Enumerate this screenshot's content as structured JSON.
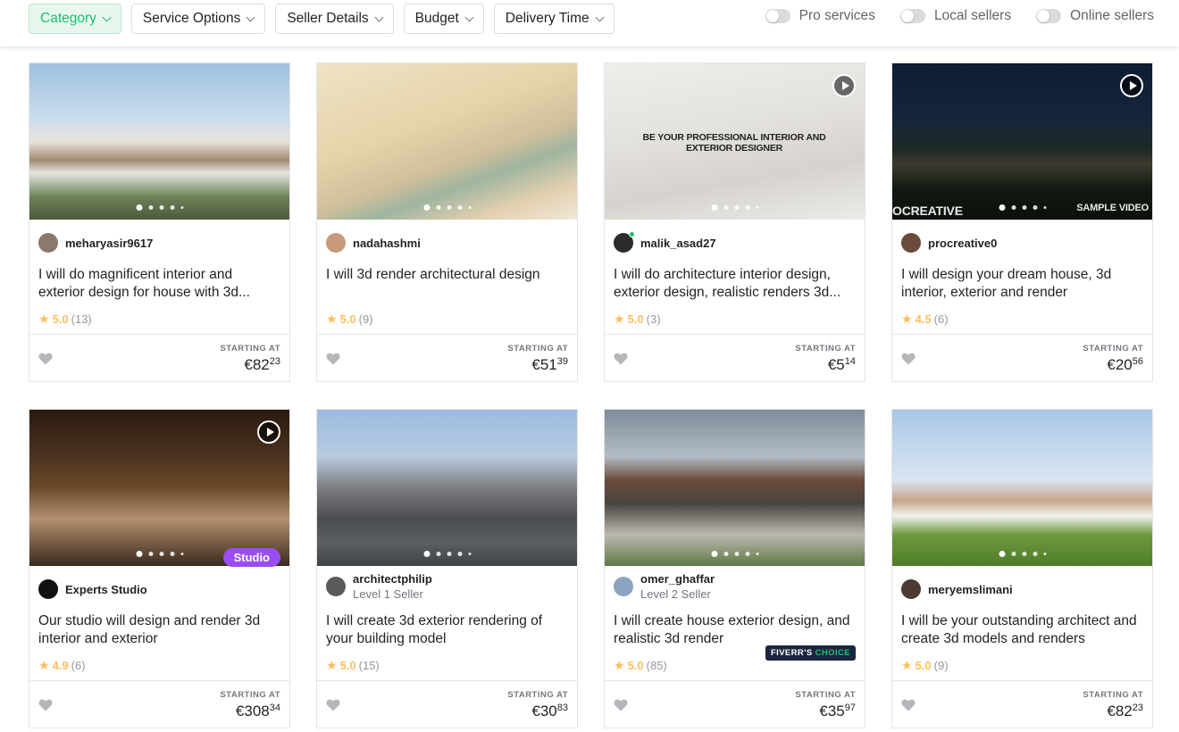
{
  "filters": [
    {
      "label": "Category",
      "active": true
    },
    {
      "label": "Service Options",
      "active": false
    },
    {
      "label": "Seller Details",
      "active": false
    },
    {
      "label": "Budget",
      "active": false
    },
    {
      "label": "Delivery Time",
      "active": false
    }
  ],
  "toggles": [
    {
      "label": "Pro services",
      "on": false
    },
    {
      "label": "Local sellers",
      "on": false
    },
    {
      "label": "Online sellers",
      "on": false
    }
  ],
  "colors": {
    "accent": "#1dbf73",
    "rating": "#ffbe5b",
    "studio_badge": "#9a4df4",
    "choice_badge": "#1c2540"
  },
  "starting_at_label": "STARTING AT",
  "gigs": [
    {
      "seller": "meharyasir9617",
      "level": "",
      "online": false,
      "title": "I will do magnificent interior and exterior design for house with 3d...",
      "rating": "5.0",
      "reviews": "(13)",
      "price_main": "€82",
      "price_cents": "23",
      "has_video": false,
      "badge": "",
      "thumb_icon": "house-exterior-image",
      "overlay": ""
    },
    {
      "seller": "nadahashmi",
      "level": "",
      "online": false,
      "title": "I will 3d render architectural design",
      "rating": "5.0",
      "reviews": "(9)",
      "price_main": "€51",
      "price_cents": "39",
      "has_video": false,
      "badge": "",
      "thumb_icon": "classic-interior-image",
      "overlay": ""
    },
    {
      "seller": "malik_asad27",
      "level": "",
      "online": true,
      "title": "I will do architecture interior design, exterior design, realistic renders 3d...",
      "rating": "5.0",
      "reviews": "(3)",
      "price_main": "€5",
      "price_cents": "14",
      "has_video": true,
      "badge": "",
      "thumb_icon": "white-interior-image",
      "overlay": "BE YOUR PROFESSIONAL INTERIOR AND EXTERIOR DESIGNER"
    },
    {
      "seller": "procreative0",
      "level": "",
      "online": false,
      "title": "I will design your dream house, 3d interior, exterior and render",
      "rating": "4.5",
      "reviews": "(6)",
      "price_main": "€20",
      "price_cents": "56",
      "has_video": true,
      "badge": "",
      "thumb_icon": "night-house-image",
      "overlay": "OCREATIVE",
      "overlay2": "SAMPLE VIDEO"
    },
    {
      "seller": "Experts Studio",
      "level": "",
      "online": false,
      "title": "Our studio will design and render 3d interior and exterior",
      "rating": "4.9",
      "reviews": "(6)",
      "price_main": "€308",
      "price_cents": "34",
      "has_video": true,
      "badge": "Studio",
      "thumb_icon": "library-interior-image",
      "overlay": ""
    },
    {
      "seller": "architectphilip",
      "level": "Level 1 Seller",
      "online": false,
      "title": "I will create 3d exterior rendering of your building model",
      "rating": "5.0",
      "reviews": "(15)",
      "price_main": "€30",
      "price_cents": "83",
      "has_video": false,
      "badge": "",
      "thumb_icon": "modern-house-image",
      "overlay": ""
    },
    {
      "seller": "omer_ghaffar",
      "level": "Level 2 Seller",
      "online": false,
      "title": "I will create house exterior design, and realistic 3d render",
      "rating": "5.0",
      "reviews": "(85)",
      "price_main": "€35",
      "price_cents": "97",
      "has_video": false,
      "badge": "choice",
      "thumb_icon": "brick-house-image",
      "overlay": ""
    },
    {
      "seller": "meryemslimani",
      "level": "",
      "online": false,
      "title": "I will be your outstanding architect and create 3d models and renders",
      "rating": "5.0",
      "reviews": "(9)",
      "price_main": "€82",
      "price_cents": "23",
      "has_video": false,
      "badge": "",
      "thumb_icon": "villa-garden-image",
      "overlay": ""
    }
  ],
  "choice_badge": {
    "part1": "FIVERR'S",
    "part2": "CHOICE"
  }
}
